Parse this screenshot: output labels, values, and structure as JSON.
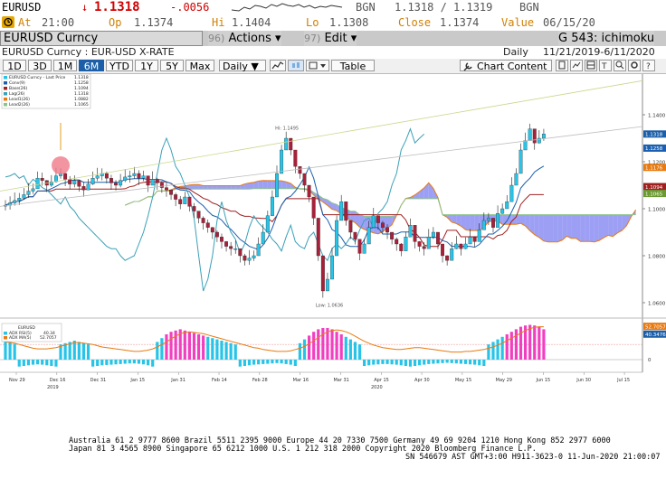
{
  "quote": {
    "ticker": "EURUSD",
    "arrow": "↓",
    "last": "1.1318",
    "change": "-.0056",
    "bgn_label": "BGN",
    "bid_ask": "1.1318 / 1.1319",
    "bgn_label2": "BGN",
    "at_label": "At",
    "time": "21:00",
    "op_label": "Op",
    "op": "1.1374",
    "hi_label": "Hi",
    "hi": "1.1404",
    "lo_label": "Lo",
    "lo": "1.1308",
    "close_label": "Close",
    "close": "1.1374",
    "value_label": "Value",
    "value_date": "06/15/20"
  },
  "toolbar": {
    "title": "EURUSD Curncy",
    "actions_num": "96)",
    "actions_label": "Actions ▾",
    "edit_num": "97)",
    "edit_label": "Edit ▾",
    "study_label": "G 543: ichimoku"
  },
  "subheader": {
    "name": "EURUSD Curncy : EUR-USD X-RATE",
    "freq": "Daily",
    "range": "11/21/2019-6/11/2020"
  },
  "periods": [
    "1D",
    "3D",
    "1M",
    "6M",
    "YTD",
    "1Y",
    "5Y",
    "Max"
  ],
  "selected_period": "6M",
  "period_dropdown": "Daily ▼",
  "table_label": "Table",
  "chart_content_label": "Chart Content",
  "colors": {
    "up": "#27c4e8",
    "down": "#a8203a",
    "conv": "#1a5fb0",
    "base": "#a02020",
    "lag": "#3aa0b8",
    "cloud": "#7b7ff0",
    "lead2": "#e87a10",
    "price_tag": "#1c5fa8"
  },
  "legend": [
    {
      "label": "EURUSD Curncy - Last Price",
      "value": "1.1318",
      "color": "#27c4e8"
    },
    {
      "label": "Conv(9)",
      "value": "1.1258",
      "color": "#1a5fb0"
    },
    {
      "label": "Base(26)",
      "value": "1.1094",
      "color": "#a02020"
    },
    {
      "label": "Lag(26)",
      "value": "1.1318",
      "color": "#3aa0b8"
    },
    {
      "label": "Lead1(26)",
      "value": "1.0882",
      "color": "#e87a10"
    },
    {
      "label": "Lead2(26)",
      "value": "1.1065",
      "color": "#8bc48b"
    }
  ],
  "chart_data": {
    "type": "candlestick",
    "y_axis": {
      "min": 1.055,
      "max": 1.155,
      "ticks": [
        "1.1400",
        "1.1200",
        "1.1000",
        "1.0800",
        "1.0600"
      ]
    },
    "price_tags": [
      {
        "value": 1.1318,
        "label": "1.1318",
        "color": "#1c5fa8"
      },
      {
        "value": 1.1258,
        "label": "1.1258",
        "color": "#1a5fb0"
      },
      {
        "label": "1.1176",
        "value": 1.1176,
        "color": "#e87a10"
      },
      {
        "label": "1.1094",
        "value": 1.1094,
        "color": "#a02020"
      },
      {
        "label": "1.1065",
        "value": 1.1065,
        "color": "#6a9a30"
      }
    ],
    "hi_annotation": "Hi: 1.1495",
    "lo_annotation": "Low: 1.0636",
    "x_labels": [
      "Nov 29",
      "Dec 16",
      "Dec 31",
      "Jan 15",
      "Jan 31",
      "Feb 14",
      "Feb 28",
      "Mar 16",
      "Mar 31",
      "Apr 15",
      "Apr 30",
      "May 15",
      "May 29",
      "Jun 15",
      "Jun 30",
      "Jul 15"
    ],
    "year_labels": [
      "2019",
      "2020"
    ],
    "closes": [
      1.1015,
      1.1025,
      1.1035,
      1.1045,
      1.106,
      1.1075,
      1.1085,
      1.113,
      1.112,
      1.11,
      1.1115,
      1.114,
      1.115,
      1.1125,
      1.1105,
      1.112,
      1.1095,
      1.108,
      1.1105,
      1.113,
      1.114,
      1.115,
      1.113,
      1.111,
      1.11,
      1.112,
      1.1135,
      1.114,
      1.115,
      1.113,
      1.114,
      1.11,
      1.1125,
      1.111,
      1.109,
      1.108,
      1.106,
      1.104,
      1.102,
      1.105,
      1.101,
      1.099,
      1.096,
      1.094,
      1.092,
      1.09,
      1.088,
      1.086,
      1.084,
      1.083,
      1.083,
      1.08,
      1.078,
      1.079,
      1.08,
      1.085,
      1.09,
      1.097,
      1.105,
      1.115,
      1.125,
      1.13,
      1.125,
      1.118,
      1.115,
      1.11,
      1.105,
      1.096,
      1.08,
      1.065,
      1.07,
      1.08,
      1.095,
      1.103,
      1.095,
      1.09,
      1.087,
      1.081,
      1.085,
      1.092,
      1.097,
      1.094,
      1.092,
      1.09,
      1.087,
      1.085,
      1.082,
      1.088,
      1.093,
      1.086,
      1.084,
      1.083,
      1.088,
      1.09,
      1.085,
      1.08,
      1.078,
      1.083,
      1.085,
      1.083,
      1.085,
      1.088,
      1.086,
      1.091,
      1.095,
      1.096,
      1.092,
      1.098,
      1.1,
      1.103,
      1.11,
      1.115,
      1.125,
      1.129,
      1.134,
      1.128,
      1.13,
      1.1318
    ],
    "adx": [
      30,
      28,
      25,
      22,
      20,
      18,
      16,
      15,
      16,
      18,
      20,
      22,
      24,
      26,
      28,
      30,
      28,
      26,
      24,
      22,
      20,
      18,
      17,
      16,
      15,
      14,
      13,
      12,
      12,
      13,
      15,
      18,
      22,
      28,
      34,
      40,
      44,
      46,
      48,
      46,
      44,
      42,
      40,
      38,
      36,
      34,
      32,
      30,
      28,
      26,
      24,
      22,
      20,
      18,
      16,
      15,
      14,
      13,
      12,
      11,
      12,
      14,
      16,
      20,
      26,
      32,
      38,
      44,
      48,
      50,
      50,
      48,
      44,
      40,
      36,
      32,
      28,
      24,
      20,
      18,
      16,
      15,
      14,
      14,
      15,
      16,
      18,
      20,
      22,
      20,
      18,
      16,
      14,
      13,
      12,
      11,
      10,
      11,
      12,
      13,
      14,
      15,
      16,
      18,
      20,
      24,
      28,
      32,
      36,
      40,
      44,
      48,
      52,
      54,
      55,
      54,
      52,
      48
    ],
    "adx_ma": [
      28,
      27,
      26,
      24,
      22,
      20,
      18,
      17,
      17,
      17,
      18,
      19,
      21,
      23,
      25,
      27,
      27,
      26,
      25,
      24,
      22,
      20,
      19,
      18,
      17,
      16,
      15,
      14,
      13,
      13,
      14,
      15,
      17,
      20,
      24,
      28,
      33,
      37,
      41,
      43,
      44,
      43,
      42,
      41,
      39,
      37,
      35,
      33,
      31,
      29,
      27,
      25,
      23,
      21,
      19,
      18,
      16,
      15,
      14,
      13,
      13,
      13,
      14,
      16,
      18,
      21,
      25,
      30,
      35,
      40,
      44,
      46,
      47,
      46,
      44,
      41,
      37,
      33,
      29,
      26,
      23,
      21,
      19,
      18,
      17,
      16,
      16,
      17,
      18,
      19,
      19,
      18,
      17,
      16,
      15,
      14,
      13,
      12,
      12,
      12,
      13,
      13,
      14,
      15,
      16,
      18,
      20,
      23,
      26,
      30,
      34,
      38,
      42,
      46,
      49,
      51,
      52,
      52
    ],
    "lower_panel": {
      "legend_title": "EURUSD",
      "adx_label": "ADX RSI(5)",
      "adx_value": "40.34",
      "ma_label": "ADX MA(5)",
      "ma_value": "52.7057",
      "y_ticks": [
        "0"
      ],
      "price_tags": [
        {
          "value": 52.7057,
          "label": "52.7057",
          "color": "#e87a10"
        },
        {
          "value": 40.34,
          "label": "40.3476",
          "color": "#1c5fa8"
        }
      ]
    }
  },
  "footer": {
    "line1": "Australia 61 2 9777 8600 Brazil 5511 2395 9000 Europe 44 20 7330 7500 Germany 49 69 9204 1210 Hong Kong 852 2977 6000",
    "line2": "Japan 81 3 4565 8900       Singapore 65 6212 1000       U.S. 1 212 318 2000          Copyright 2020 Bloomberg Finance L.P.",
    "line3": "SN 546679 AST  GMT+3:00 H911-3623-0 11-Jun-2020 21:00:07"
  }
}
